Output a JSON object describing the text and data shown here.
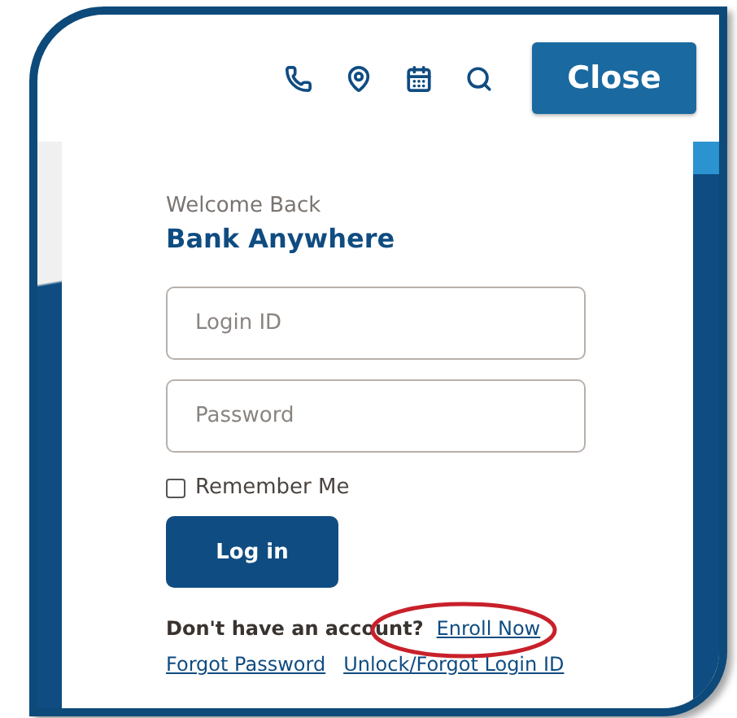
{
  "header": {
    "close_button": "Close"
  },
  "login": {
    "greeting": "Welcome Back",
    "title": "Bank Anywhere",
    "fields": [
      {
        "placeholder": "Login ID"
      },
      {
        "placeholder": "Password"
      }
    ],
    "remember": {
      "label": "Remember Me",
      "checked": false
    },
    "login_button": "Log in",
    "enroll": {
      "prompt": "Don't have an account?",
      "link": "Enroll Now",
      "circled": true
    },
    "links": [
      "Forgot Password",
      "Unlock/Forgot Login ID"
    ]
  }
}
